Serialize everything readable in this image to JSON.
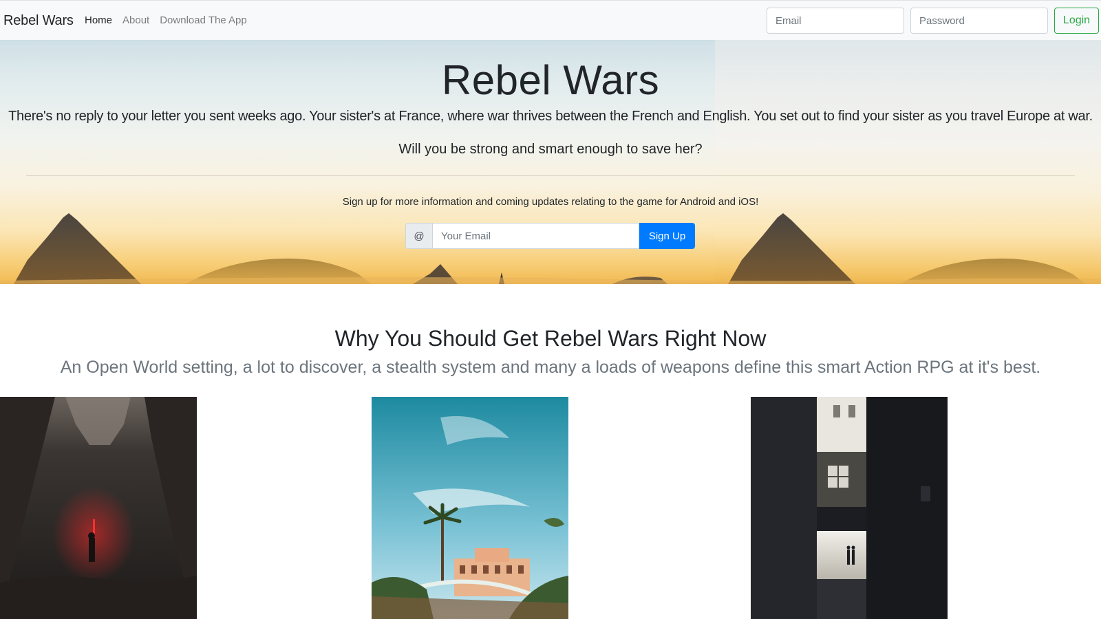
{
  "navbar": {
    "brand": "Rebel Wars",
    "links": [
      {
        "label": "Home",
        "active": true
      },
      {
        "label": "About",
        "active": false
      },
      {
        "label": "Download The App",
        "active": false
      }
    ],
    "email_placeholder": "Email",
    "password_placeholder": "Password",
    "login_label": "Login"
  },
  "hero": {
    "title": "Rebel Wars",
    "lead": "There's no reply to your letter you sent weeks ago. Your sister's at France, where war thrives between the French and English. You set out to find your sister as you travel Europe at war.",
    "question": "Will you be strong and smart enough to save her?",
    "signup_text": "Sign up for more information and coming updates relating to the game for Android and iOS!",
    "at_symbol": "@",
    "email_placeholder": "Your Email",
    "signup_label": "Sign Up"
  },
  "features": {
    "title": "Why You Should Get Rebel Wars Right Now",
    "subtitle": "An Open World setting, a lot to discover, a stealth system and many a loads of weapons define this smart Action RPG at it's best.",
    "images": [
      {
        "name": "cave-photo"
      },
      {
        "name": "palm-tree-villa-photo"
      },
      {
        "name": "dark-alley-photo"
      }
    ]
  },
  "colors": {
    "login_green": "#28a745",
    "signup_blue": "#007bff",
    "navbar_bg": "#f8f9fa",
    "muted_text": "#6c757d"
  }
}
